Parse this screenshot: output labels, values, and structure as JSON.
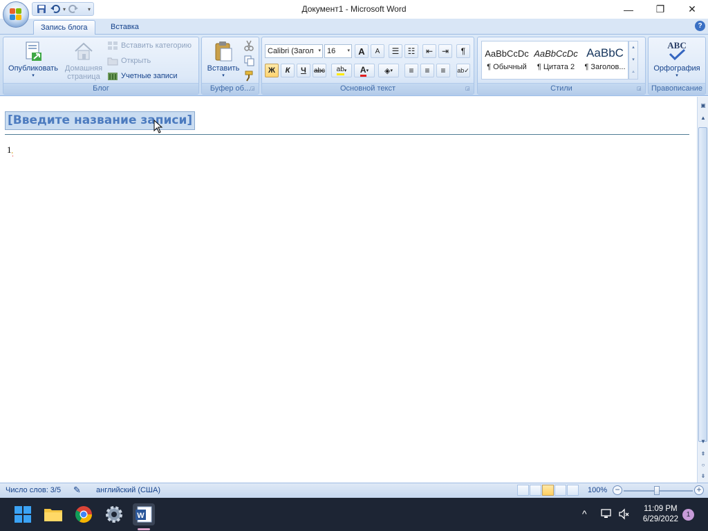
{
  "window": {
    "title": "Документ1 - Microsoft Word",
    "minimize": "—",
    "maximize": "❐",
    "close": "✕"
  },
  "quick_access": {
    "save_icon": "save-icon",
    "undo_icon": "undo-icon",
    "redo_icon": "redo-icon"
  },
  "ribbon_tabs": [
    {
      "label": "Запись блога",
      "active": true
    },
    {
      "label": "Вставка",
      "active": false
    }
  ],
  "help_label": "?",
  "groups": {
    "blog": {
      "label": "Блог",
      "publish": "Опубликовать",
      "home_line1": "Домашняя",
      "home_line2": "страница",
      "insert_category": "Вставить категорию",
      "open": "Открыть",
      "accounts": "Учетные записи"
    },
    "clipboard": {
      "label": "Буфер об...",
      "paste": "Вставить"
    },
    "basic_text": {
      "label": "Основной текст",
      "font": "Calibri (Загол",
      "size": "16",
      "grow": "A",
      "shrink": "A",
      "bold": "Ж",
      "italic": "К",
      "underline": "Ч",
      "strike": "abc",
      "pilcrow": "¶"
    },
    "styles": {
      "label": "Стили",
      "items": [
        {
          "preview": "AaBbCcDc",
          "name": "¶ Обычный"
        },
        {
          "preview": "AaBbCcDc",
          "name": "¶ Цитата 2"
        },
        {
          "preview": "AaBbC",
          "name": "¶ Заголов..."
        }
      ]
    },
    "proofing": {
      "label": "Правописание",
      "spelling": "Орфография",
      "abc": "ABC"
    }
  },
  "document": {
    "title_placeholder": "[Введите название записи]",
    "body": "1"
  },
  "status": {
    "word_count": "Число слов: 3/5",
    "language": "английский (США)",
    "zoom": "100%"
  },
  "taskbar": {
    "time": "11:09 PM",
    "date": "6/29/2022",
    "notification_count": "1"
  },
  "colors": {
    "ribbon_bg": "#c7daf1",
    "accent": "#15428b",
    "taskbar_bg": "#1d2534"
  }
}
